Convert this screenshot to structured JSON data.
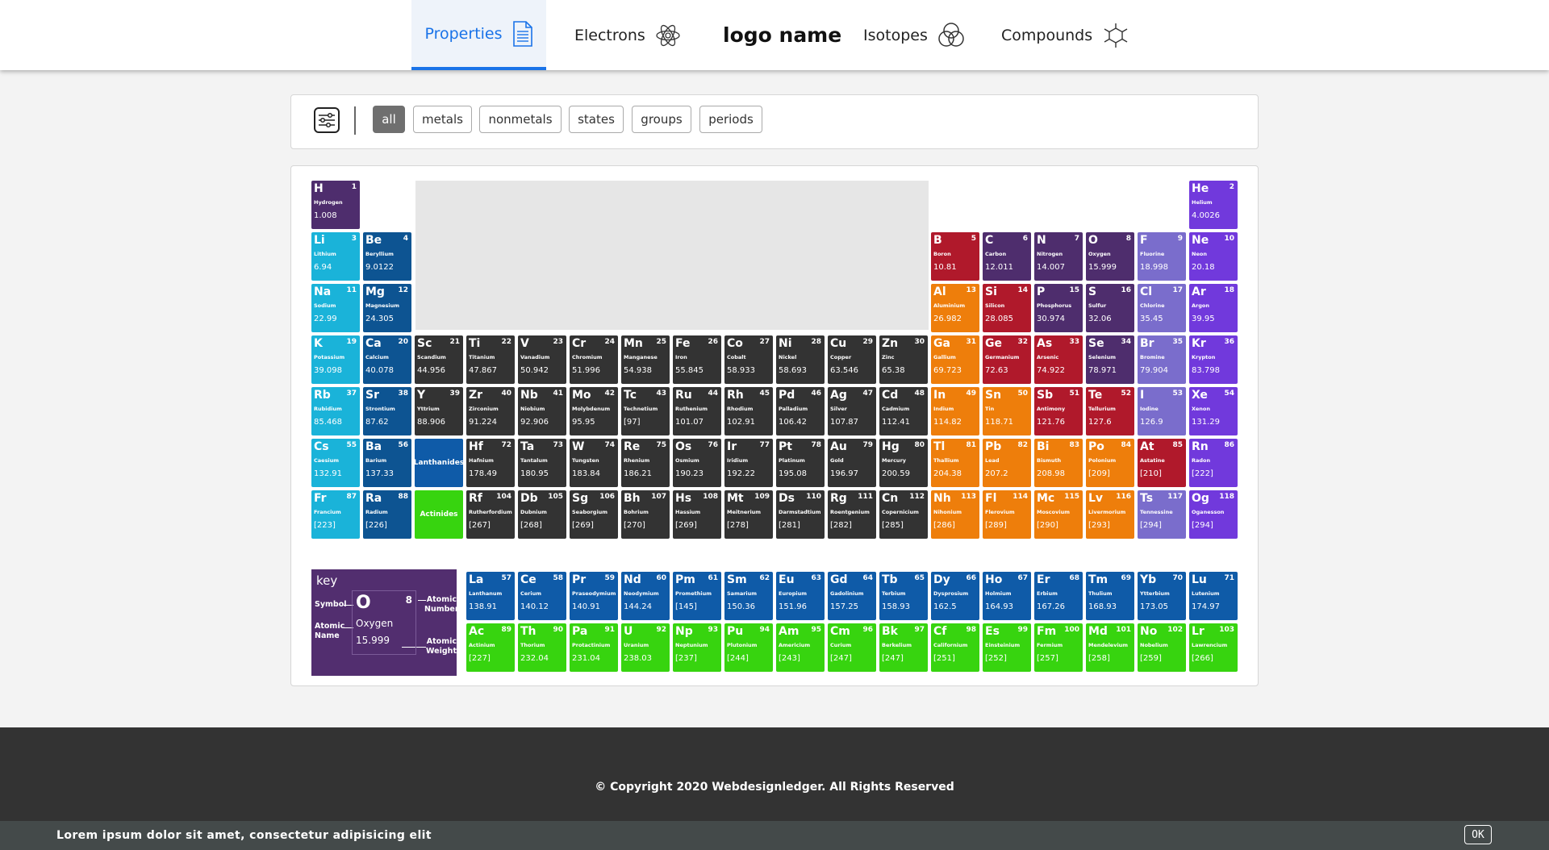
{
  "nav": {
    "items": [
      {
        "label": "Properties",
        "icon": "document-icon",
        "active": true
      },
      {
        "label": "Electrons",
        "icon": "atom-icon",
        "active": false
      },
      {
        "label": "Isotopes",
        "icon": "venn-circles-icon",
        "active": false
      },
      {
        "label": "Compounds",
        "icon": "molecule-icon",
        "active": false
      }
    ],
    "logo": "logo name"
  },
  "filters": [
    "all",
    "metals",
    "nonmetals",
    "states",
    "groups",
    "periods"
  ],
  "active_filter": "all",
  "colors": {
    "alkali": "#1ab3d9",
    "alkaline": "#0d5492",
    "transition": "#333333",
    "post_transition": "#ee7e0b",
    "metalloid": "#b0192b",
    "nonmetal": "#4e2d6d",
    "halogen": "#7a6dcc",
    "noble": "#7139dc",
    "lanthanide": "#0f5ba8",
    "actinide": "#37d40f",
    "key_bg": "#522e6f"
  },
  "elements": [
    {
      "sym": "H",
      "num": 1,
      "name": "Hydrogen",
      "wt": "1.008",
      "row": 1,
      "col": 1,
      "cat": "nonmetal"
    },
    {
      "sym": "He",
      "num": 2,
      "name": "Helium",
      "wt": "4.0026",
      "row": 1,
      "col": 18,
      "cat": "noble"
    },
    {
      "sym": "Li",
      "num": 3,
      "name": "Lithium",
      "wt": "6.94",
      "row": 2,
      "col": 1,
      "cat": "alkali"
    },
    {
      "sym": "Be",
      "num": 4,
      "name": "Beryllium",
      "wt": "9.0122",
      "row": 2,
      "col": 2,
      "cat": "alkaline"
    },
    {
      "sym": "B",
      "num": 5,
      "name": "Boron",
      "wt": "10.81",
      "row": 2,
      "col": 13,
      "cat": "metalloid"
    },
    {
      "sym": "C",
      "num": 6,
      "name": "Carbon",
      "wt": "12.011",
      "row": 2,
      "col": 14,
      "cat": "nonmetal"
    },
    {
      "sym": "N",
      "num": 7,
      "name": "Nitrogen",
      "wt": "14.007",
      "row": 2,
      "col": 15,
      "cat": "nonmetal"
    },
    {
      "sym": "O",
      "num": 8,
      "name": "Oxygen",
      "wt": "15.999",
      "row": 2,
      "col": 16,
      "cat": "nonmetal"
    },
    {
      "sym": "F",
      "num": 9,
      "name": "Fluorine",
      "wt": "18.998",
      "row": 2,
      "col": 17,
      "cat": "halogen"
    },
    {
      "sym": "Ne",
      "num": 10,
      "name": "Neon",
      "wt": "20.18",
      "row": 2,
      "col": 18,
      "cat": "noble"
    },
    {
      "sym": "Na",
      "num": 11,
      "name": "Sodium",
      "wt": "22.99",
      "row": 3,
      "col": 1,
      "cat": "alkali"
    },
    {
      "sym": "Mg",
      "num": 12,
      "name": "Magnesium",
      "wt": "24.305",
      "row": 3,
      "col": 2,
      "cat": "alkaline"
    },
    {
      "sym": "Al",
      "num": 13,
      "name": "Aluminium",
      "wt": "26.982",
      "row": 3,
      "col": 13,
      "cat": "post_transition"
    },
    {
      "sym": "Si",
      "num": 14,
      "name": "Silicon",
      "wt": "28.085",
      "row": 3,
      "col": 14,
      "cat": "metalloid"
    },
    {
      "sym": "P",
      "num": 15,
      "name": "Phosphorus",
      "wt": "30.974",
      "row": 3,
      "col": 15,
      "cat": "nonmetal"
    },
    {
      "sym": "S",
      "num": 16,
      "name": "Sulfur",
      "wt": "32.06",
      "row": 3,
      "col": 16,
      "cat": "nonmetal"
    },
    {
      "sym": "Cl",
      "num": 17,
      "name": "Chlorine",
      "wt": "35.45",
      "row": 3,
      "col": 17,
      "cat": "halogen"
    },
    {
      "sym": "Ar",
      "num": 18,
      "name": "Argon",
      "wt": "39.95",
      "row": 3,
      "col": 18,
      "cat": "noble"
    },
    {
      "sym": "K",
      "num": 19,
      "name": "Potassium",
      "wt": "39.098",
      "row": 4,
      "col": 1,
      "cat": "alkali"
    },
    {
      "sym": "Ca",
      "num": 20,
      "name": "Calcium",
      "wt": "40.078",
      "row": 4,
      "col": 2,
      "cat": "alkaline"
    },
    {
      "sym": "Sc",
      "num": 21,
      "name": "Scandium",
      "wt": "44.956",
      "row": 4,
      "col": 3,
      "cat": "transition"
    },
    {
      "sym": "Ti",
      "num": 22,
      "name": "Titanium",
      "wt": "47.867",
      "row": 4,
      "col": 4,
      "cat": "transition"
    },
    {
      "sym": "V",
      "num": 23,
      "name": "Vanadium",
      "wt": "50.942",
      "row": 4,
      "col": 5,
      "cat": "transition"
    },
    {
      "sym": "Cr",
      "num": 24,
      "name": "Chromium",
      "wt": "51.996",
      "row": 4,
      "col": 6,
      "cat": "transition"
    },
    {
      "sym": "Mn",
      "num": 25,
      "name": "Manganese",
      "wt": "54.938",
      "row": 4,
      "col": 7,
      "cat": "transition"
    },
    {
      "sym": "Fe",
      "num": 26,
      "name": "Iron",
      "wt": "55.845",
      "row": 4,
      "col": 8,
      "cat": "transition"
    },
    {
      "sym": "Co",
      "num": 27,
      "name": "Cobalt",
      "wt": "58.933",
      "row": 4,
      "col": 9,
      "cat": "transition"
    },
    {
      "sym": "Ni",
      "num": 28,
      "name": "Nickel",
      "wt": "58.693",
      "row": 4,
      "col": 10,
      "cat": "transition"
    },
    {
      "sym": "Cu",
      "num": 29,
      "name": "Copper",
      "wt": "63.546",
      "row": 4,
      "col": 11,
      "cat": "transition"
    },
    {
      "sym": "Zn",
      "num": 30,
      "name": "Zinc",
      "wt": "65.38",
      "row": 4,
      "col": 12,
      "cat": "transition"
    },
    {
      "sym": "Ga",
      "num": 31,
      "name": "Gallium",
      "wt": "69.723",
      "row": 4,
      "col": 13,
      "cat": "post_transition"
    },
    {
      "sym": "Ge",
      "num": 32,
      "name": "Germanium",
      "wt": "72.63",
      "row": 4,
      "col": 14,
      "cat": "metalloid"
    },
    {
      "sym": "As",
      "num": 33,
      "name": "Arsenic",
      "wt": "74.922",
      "row": 4,
      "col": 15,
      "cat": "metalloid"
    },
    {
      "sym": "Se",
      "num": 34,
      "name": "Selenium",
      "wt": "78.971",
      "row": 4,
      "col": 16,
      "cat": "nonmetal"
    },
    {
      "sym": "Br",
      "num": 35,
      "name": "Bromine",
      "wt": "79.904",
      "row": 4,
      "col": 17,
      "cat": "halogen"
    },
    {
      "sym": "Kr",
      "num": 36,
      "name": "Krypton",
      "wt": "83.798",
      "row": 4,
      "col": 18,
      "cat": "noble"
    },
    {
      "sym": "Rb",
      "num": 37,
      "name": "Rubidium",
      "wt": "85.468",
      "row": 5,
      "col": 1,
      "cat": "alkali"
    },
    {
      "sym": "Sr",
      "num": 38,
      "name": "Strontium",
      "wt": "87.62",
      "row": 5,
      "col": 2,
      "cat": "alkaline"
    },
    {
      "sym": "Y",
      "num": 39,
      "name": "Yttrium",
      "wt": "88.906",
      "row": 5,
      "col": 3,
      "cat": "transition"
    },
    {
      "sym": "Zr",
      "num": 40,
      "name": "Zirconium",
      "wt": "91.224",
      "row": 5,
      "col": 4,
      "cat": "transition"
    },
    {
      "sym": "Nb",
      "num": 41,
      "name": "Niobium",
      "wt": "92.906",
      "row": 5,
      "col": 5,
      "cat": "transition"
    },
    {
      "sym": "Mo",
      "num": 42,
      "name": "Molybdenum",
      "wt": "95.95",
      "row": 5,
      "col": 6,
      "cat": "transition"
    },
    {
      "sym": "Tc",
      "num": 43,
      "name": "Technetium",
      "wt": "[97]",
      "row": 5,
      "col": 7,
      "cat": "transition"
    },
    {
      "sym": "Ru",
      "num": 44,
      "name": "Ruthenium",
      "wt": "101.07",
      "row": 5,
      "col": 8,
      "cat": "transition"
    },
    {
      "sym": "Rh",
      "num": 45,
      "name": "Rhodium",
      "wt": "102.91",
      "row": 5,
      "col": 9,
      "cat": "transition"
    },
    {
      "sym": "Pd",
      "num": 46,
      "name": "Palladium",
      "wt": "106.42",
      "row": 5,
      "col": 10,
      "cat": "transition"
    },
    {
      "sym": "Ag",
      "num": 47,
      "name": "Silver",
      "wt": "107.87",
      "row": 5,
      "col": 11,
      "cat": "transition"
    },
    {
      "sym": "Cd",
      "num": 48,
      "name": "Cadmium",
      "wt": "112.41",
      "row": 5,
      "col": 12,
      "cat": "transition"
    },
    {
      "sym": "In",
      "num": 49,
      "name": "Indium",
      "wt": "114.82",
      "row": 5,
      "col": 13,
      "cat": "post_transition"
    },
    {
      "sym": "Sn",
      "num": 50,
      "name": "Tin",
      "wt": "118.71",
      "row": 5,
      "col": 14,
      "cat": "post_transition"
    },
    {
      "sym": "Sb",
      "num": 51,
      "name": "Antimony",
      "wt": "121.76",
      "row": 5,
      "col": 15,
      "cat": "metalloid"
    },
    {
      "sym": "Te",
      "num": 52,
      "name": "Tellurium",
      "wt": "127.6",
      "row": 5,
      "col": 16,
      "cat": "metalloid"
    },
    {
      "sym": "I",
      "num": 53,
      "name": "Iodine",
      "wt": "126.9",
      "row": 5,
      "col": 17,
      "cat": "halogen"
    },
    {
      "sym": "Xe",
      "num": 54,
      "name": "Xenon",
      "wt": "131.29",
      "row": 5,
      "col": 18,
      "cat": "noble"
    },
    {
      "sym": "Cs",
      "num": 55,
      "name": "Caesium",
      "wt": "132.91",
      "row": 6,
      "col": 1,
      "cat": "alkali"
    },
    {
      "sym": "Ba",
      "num": 56,
      "name": "Barium",
      "wt": "137.33",
      "row": 6,
      "col": 2,
      "cat": "alkaline"
    },
    {
      "sym": "Hf",
      "num": 72,
      "name": "Hafnium",
      "wt": "178.49",
      "row": 6,
      "col": 4,
      "cat": "transition"
    },
    {
      "sym": "Ta",
      "num": 73,
      "name": "Tantalum",
      "wt": "180.95",
      "row": 6,
      "col": 5,
      "cat": "transition"
    },
    {
      "sym": "W",
      "num": 74,
      "name": "Tungsten",
      "wt": "183.84",
      "row": 6,
      "col": 6,
      "cat": "transition"
    },
    {
      "sym": "Re",
      "num": 75,
      "name": "Rhenium",
      "wt": "186.21",
      "row": 6,
      "col": 7,
      "cat": "transition"
    },
    {
      "sym": "Os",
      "num": 76,
      "name": "Osmium",
      "wt": "190.23",
      "row": 6,
      "col": 8,
      "cat": "transition"
    },
    {
      "sym": "Ir",
      "num": 77,
      "name": "Iridium",
      "wt": "192.22",
      "row": 6,
      "col": 9,
      "cat": "transition"
    },
    {
      "sym": "Pt",
      "num": 78,
      "name": "Platinum",
      "wt": "195.08",
      "row": 6,
      "col": 10,
      "cat": "transition"
    },
    {
      "sym": "Au",
      "num": 79,
      "name": "Gold",
      "wt": "196.97",
      "row": 6,
      "col": 11,
      "cat": "transition"
    },
    {
      "sym": "Hg",
      "num": 80,
      "name": "Mercury",
      "wt": "200.59",
      "row": 6,
      "col": 12,
      "cat": "transition"
    },
    {
      "sym": "Tl",
      "num": 81,
      "name": "Thallium",
      "wt": "204.38",
      "row": 6,
      "col": 13,
      "cat": "post_transition"
    },
    {
      "sym": "Pb",
      "num": 82,
      "name": "Lead",
      "wt": "207.2",
      "row": 6,
      "col": 14,
      "cat": "post_transition"
    },
    {
      "sym": "Bi",
      "num": 83,
      "name": "Bismuth",
      "wt": "208.98",
      "row": 6,
      "col": 15,
      "cat": "post_transition"
    },
    {
      "sym": "Po",
      "num": 84,
      "name": "Polonium",
      "wt": "[209]",
      "row": 6,
      "col": 16,
      "cat": "post_transition"
    },
    {
      "sym": "At",
      "num": 85,
      "name": "Astatine",
      "wt": "[210]",
      "row": 6,
      "col": 17,
      "cat": "metalloid"
    },
    {
      "sym": "Rn",
      "num": 86,
      "name": "Radon",
      "wt": "[222]",
      "row": 6,
      "col": 18,
      "cat": "noble"
    },
    {
      "sym": "Fr",
      "num": 87,
      "name": "Francium",
      "wt": "[223]",
      "row": 7,
      "col": 1,
      "cat": "alkali"
    },
    {
      "sym": "Ra",
      "num": 88,
      "name": "Radium",
      "wt": "[226]",
      "row": 7,
      "col": 2,
      "cat": "alkaline"
    },
    {
      "sym": "Rf",
      "num": 104,
      "name": "Rutherfordium",
      "wt": "[267]",
      "row": 7,
      "col": 4,
      "cat": "transition"
    },
    {
      "sym": "Db",
      "num": 105,
      "name": "Dubnium",
      "wt": "[268]",
      "row": 7,
      "col": 5,
      "cat": "transition"
    },
    {
      "sym": "Sg",
      "num": 106,
      "name": "Seaborgium",
      "wt": "[269]",
      "row": 7,
      "col": 6,
      "cat": "transition"
    },
    {
      "sym": "Bh",
      "num": 107,
      "name": "Bohrium",
      "wt": "[270]",
      "row": 7,
      "col": 7,
      "cat": "transition"
    },
    {
      "sym": "Hs",
      "num": 108,
      "name": "Hassium",
      "wt": "[269]",
      "row": 7,
      "col": 8,
      "cat": "transition"
    },
    {
      "sym": "Mt",
      "num": 109,
      "name": "Meitnerium",
      "wt": "[278]",
      "row": 7,
      "col": 9,
      "cat": "transition"
    },
    {
      "sym": "Ds",
      "num": 110,
      "name": "Darmstadtium",
      "wt": "[281]",
      "row": 7,
      "col": 10,
      "cat": "transition"
    },
    {
      "sym": "Rg",
      "num": 111,
      "name": "Roentgenium",
      "wt": "[282]",
      "row": 7,
      "col": 11,
      "cat": "transition"
    },
    {
      "sym": "Cn",
      "num": 112,
      "name": "Copernicium",
      "wt": "[285]",
      "row": 7,
      "col": 12,
      "cat": "transition"
    },
    {
      "sym": "Nh",
      "num": 113,
      "name": "Nihonium",
      "wt": "[286]",
      "row": 7,
      "col": 13,
      "cat": "post_transition"
    },
    {
      "sym": "Fl",
      "num": 114,
      "name": "Flerovium",
      "wt": "[289]",
      "row": 7,
      "col": 14,
      "cat": "post_transition"
    },
    {
      "sym": "Mc",
      "num": 115,
      "name": "Moscovium",
      "wt": "[290]",
      "row": 7,
      "col": 15,
      "cat": "post_transition"
    },
    {
      "sym": "Lv",
      "num": 116,
      "name": "Livermorium",
      "wt": "[293]",
      "row": 7,
      "col": 16,
      "cat": "post_transition"
    },
    {
      "sym": "Ts",
      "num": 117,
      "name": "Tennessine",
      "wt": "[294]",
      "row": 7,
      "col": 17,
      "cat": "halogen"
    },
    {
      "sym": "Og",
      "num": 118,
      "name": "Oganesson",
      "wt": "[294]",
      "row": 7,
      "col": 18,
      "cat": "noble"
    }
  ],
  "blocks": [
    {
      "label": "Lanthanides",
      "row": 6,
      "col": 3,
      "cat": "lanthanide"
    },
    {
      "label": "Actinides",
      "row": 7,
      "col": 3,
      "cat": "actinide"
    }
  ],
  "f_block": [
    {
      "sym": "La",
      "num": 57,
      "name": "Lanthanum",
      "wt": "138.91",
      "row": 1,
      "col": 1,
      "cat": "lanthanide"
    },
    {
      "sym": "Ce",
      "num": 58,
      "name": "Cerium",
      "wt": "140.12",
      "row": 1,
      "col": 2,
      "cat": "lanthanide"
    },
    {
      "sym": "Pr",
      "num": 59,
      "name": "Praseodymium",
      "wt": "140.91",
      "row": 1,
      "col": 3,
      "cat": "lanthanide"
    },
    {
      "sym": "Nd",
      "num": 60,
      "name": "Neodymium",
      "wt": "144.24",
      "row": 1,
      "col": 4,
      "cat": "lanthanide"
    },
    {
      "sym": "Pm",
      "num": 61,
      "name": "Promethium",
      "wt": "[145]",
      "row": 1,
      "col": 5,
      "cat": "lanthanide"
    },
    {
      "sym": "Sm",
      "num": 62,
      "name": "Samarium",
      "wt": "150.36",
      "row": 1,
      "col": 6,
      "cat": "lanthanide"
    },
    {
      "sym": "Eu",
      "num": 63,
      "name": "Europium",
      "wt": "151.96",
      "row": 1,
      "col": 7,
      "cat": "lanthanide"
    },
    {
      "sym": "Gd",
      "num": 64,
      "name": "Gadolinium",
      "wt": "157.25",
      "row": 1,
      "col": 8,
      "cat": "lanthanide"
    },
    {
      "sym": "Tb",
      "num": 65,
      "name": "Terbium",
      "wt": "158.93",
      "row": 1,
      "col": 9,
      "cat": "lanthanide"
    },
    {
      "sym": "Dy",
      "num": 66,
      "name": "Dysprosium",
      "wt": "162.5",
      "row": 1,
      "col": 10,
      "cat": "lanthanide"
    },
    {
      "sym": "Ho",
      "num": 67,
      "name": "Holmium",
      "wt": "164.93",
      "row": 1,
      "col": 11,
      "cat": "lanthanide"
    },
    {
      "sym": "Er",
      "num": 68,
      "name": "Erbium",
      "wt": "167.26",
      "row": 1,
      "col": 12,
      "cat": "lanthanide"
    },
    {
      "sym": "Tm",
      "num": 69,
      "name": "Thulium",
      "wt": "168.93",
      "row": 1,
      "col": 13,
      "cat": "lanthanide"
    },
    {
      "sym": "Yb",
      "num": 70,
      "name": "Ytterbium",
      "wt": "173.05",
      "row": 1,
      "col": 14,
      "cat": "lanthanide"
    },
    {
      "sym": "Lu",
      "num": 71,
      "name": "Lutenium",
      "wt": "174.97",
      "row": 1,
      "col": 15,
      "cat": "lanthanide"
    },
    {
      "sym": "Ac",
      "num": 89,
      "name": "Actinium",
      "wt": "[227]",
      "row": 2,
      "col": 1,
      "cat": "actinide"
    },
    {
      "sym": "Th",
      "num": 90,
      "name": "Thorium",
      "wt": "232.04",
      "row": 2,
      "col": 2,
      "cat": "actinide"
    },
    {
      "sym": "Pa",
      "num": 91,
      "name": "Protactinium",
      "wt": "231.04",
      "row": 2,
      "col": 3,
      "cat": "actinide"
    },
    {
      "sym": "U",
      "num": 92,
      "name": "Uranium",
      "wt": "238.03",
      "row": 2,
      "col": 4,
      "cat": "actinide"
    },
    {
      "sym": "Np",
      "num": 93,
      "name": "Neptunium",
      "wt": "[237]",
      "row": 2,
      "col": 5,
      "cat": "actinide"
    },
    {
      "sym": "Pu",
      "num": 94,
      "name": "Plutonium",
      "wt": "[244]",
      "row": 2,
      "col": 6,
      "cat": "actinide"
    },
    {
      "sym": "Am",
      "num": 95,
      "name": "Americium",
      "wt": "[243]",
      "row": 2,
      "col": 7,
      "cat": "actinide"
    },
    {
      "sym": "Cm",
      "num": 96,
      "name": "Curium",
      "wt": "[247]",
      "row": 2,
      "col": 8,
      "cat": "actinide"
    },
    {
      "sym": "Bk",
      "num": 97,
      "name": "Berkelium",
      "wt": "[247]",
      "row": 2,
      "col": 9,
      "cat": "actinide"
    },
    {
      "sym": "Cf",
      "num": 98,
      "name": "Californium",
      "wt": "[251]",
      "row": 2,
      "col": 10,
      "cat": "actinide"
    },
    {
      "sym": "Es",
      "num": 99,
      "name": "Einsteinium",
      "wt": "[252]",
      "row": 2,
      "col": 11,
      "cat": "actinide"
    },
    {
      "sym": "Fm",
      "num": 100,
      "name": "Fermium",
      "wt": "[257]",
      "row": 2,
      "col": 12,
      "cat": "actinide"
    },
    {
      "sym": "Md",
      "num": 101,
      "name": "Mendelevium",
      "wt": "[258]",
      "row": 2,
      "col": 13,
      "cat": "actinide"
    },
    {
      "sym": "No",
      "num": 102,
      "name": "Nobelium",
      "wt": "[259]",
      "row": 2,
      "col": 14,
      "cat": "actinide"
    },
    {
      "sym": "Lr",
      "num": 103,
      "name": "Lawrencium",
      "wt": "[266]",
      "row": 2,
      "col": 15,
      "cat": "actinide"
    }
  ],
  "key": {
    "title": "key",
    "symbol_label": "Symbol",
    "name_label": "Atomic Name",
    "number_label": "Atomic Number",
    "weight_label": "Atomic Weight",
    "sample": {
      "sym": "O",
      "num": "8",
      "name": "Oxygen",
      "wt": "15.999"
    }
  },
  "footer": {
    "copyright": "© Copyright 2020 Webdesignledger. All Rights Reserved",
    "cookie_text": "Lorem ipsum dolor sit amet, consectetur adipisicing elit",
    "ok_label": "OK"
  }
}
